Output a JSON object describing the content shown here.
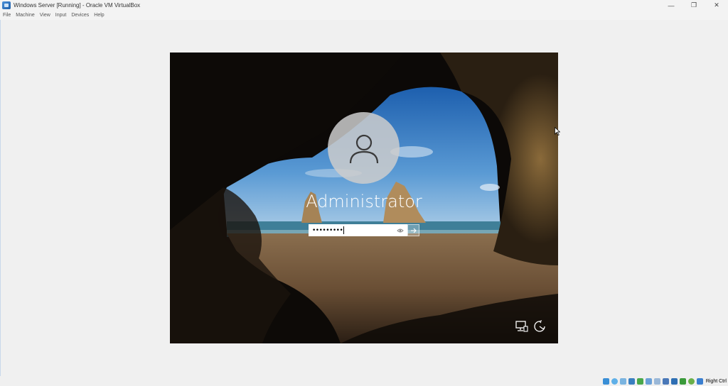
{
  "window": {
    "title": "Windows Server [Running] - Oracle VM VirtualBox",
    "minimize_glyph": "—",
    "restore_glyph": "❐",
    "close_glyph": "✕"
  },
  "menu": {
    "items": [
      {
        "label": "File"
      },
      {
        "label": "Machine"
      },
      {
        "label": "View"
      },
      {
        "label": "Input"
      },
      {
        "label": "Devices"
      },
      {
        "label": "Help"
      }
    ]
  },
  "login": {
    "username": "Administrator",
    "password_masked": "•••••••••",
    "submit_icon": "arrow-right-icon",
    "reveal_icon": "eye-icon"
  },
  "lockscreen_icons": {
    "network": "network-icon",
    "ease_of_access": "ease-of-access-icon"
  },
  "statusbar": {
    "host_key": "Right Ctrl",
    "icons": [
      {
        "name": "hard-disk-icon",
        "color": "#3a8fd6"
      },
      {
        "name": "optical-drive-icon",
        "color": "#5fb0e8"
      },
      {
        "name": "audio-icon",
        "color": "#7ab4e0"
      },
      {
        "name": "network-adapter-icon",
        "color": "#3a7fc0"
      },
      {
        "name": "usb-icon",
        "color": "#4aa84a"
      },
      {
        "name": "shared-folder-icon",
        "color": "#6aa0d8"
      },
      {
        "name": "display-icon",
        "color": "#9ab8d8"
      },
      {
        "name": "recording-icon",
        "color": "#4a78b8"
      },
      {
        "name": "cpu-icon",
        "color": "#2f6fb4"
      },
      {
        "name": "mouse-integration-icon",
        "color": "#3a9a3a"
      },
      {
        "name": "guest-additions-icon",
        "color": "#6ab04a"
      },
      {
        "name": "keyboard-capture-icon",
        "color": "#3a7fd0"
      }
    ]
  }
}
